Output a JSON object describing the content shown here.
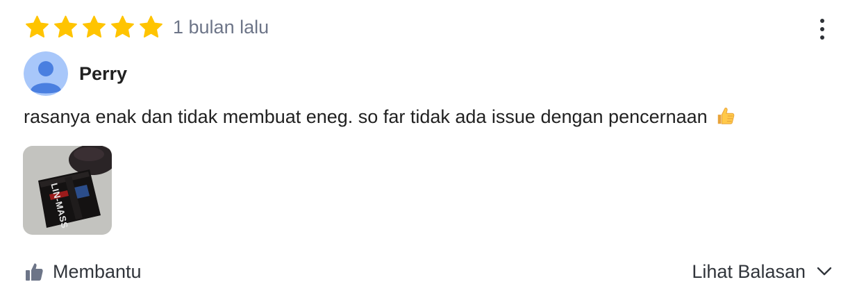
{
  "review": {
    "rating": 5,
    "max_rating": 5,
    "time_ago": "1 bulan lalu",
    "user": {
      "name": "Perry",
      "avatar_icon": "default-avatar-icon"
    },
    "text": "rasanya enak dan tidak membuat eneg. so far tidak ada issue dengan pencernaan",
    "emoji_icon": "thumbs-up-emoji",
    "photo": {
      "product_label": "LIN-MASS"
    }
  },
  "actions": {
    "helpful_label": "Membantu",
    "replies_label": "Lihat Balasan",
    "more_icon": "more-vertical-icon"
  },
  "colors": {
    "star": "#FFC400",
    "time_text": "#6D7588",
    "text": "#212121",
    "avatar_bg": "#A8C7FA",
    "avatar_fg": "#4A7FE0"
  }
}
